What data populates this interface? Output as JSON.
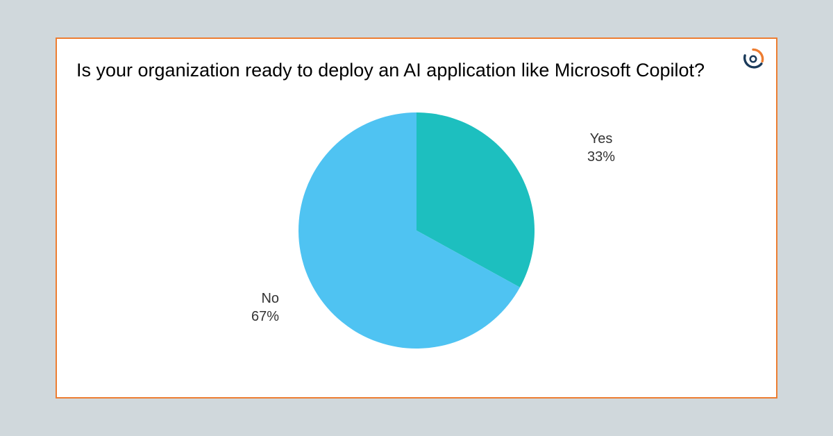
{
  "title": "Is your organization ready to deploy an AI application like Microsoft Copilot?",
  "labels": {
    "yes_name": "Yes",
    "yes_pct": "33%",
    "no_name": "No",
    "no_pct": "67%"
  },
  "colors": {
    "border": "#ed7d31",
    "yes_slice": "#1dbfbf",
    "no_slice": "#4fc3f2",
    "page_bg": "#d0d8dc",
    "card_bg": "#ffffff"
  },
  "chart_data": {
    "type": "pie",
    "title": "Is your organization ready to deploy an AI application like Microsoft Copilot?",
    "series": [
      {
        "name": "Yes",
        "value": 33,
        "color": "#1dbfbf"
      },
      {
        "name": "No",
        "value": 67,
        "color": "#4fc3f2"
      }
    ]
  }
}
